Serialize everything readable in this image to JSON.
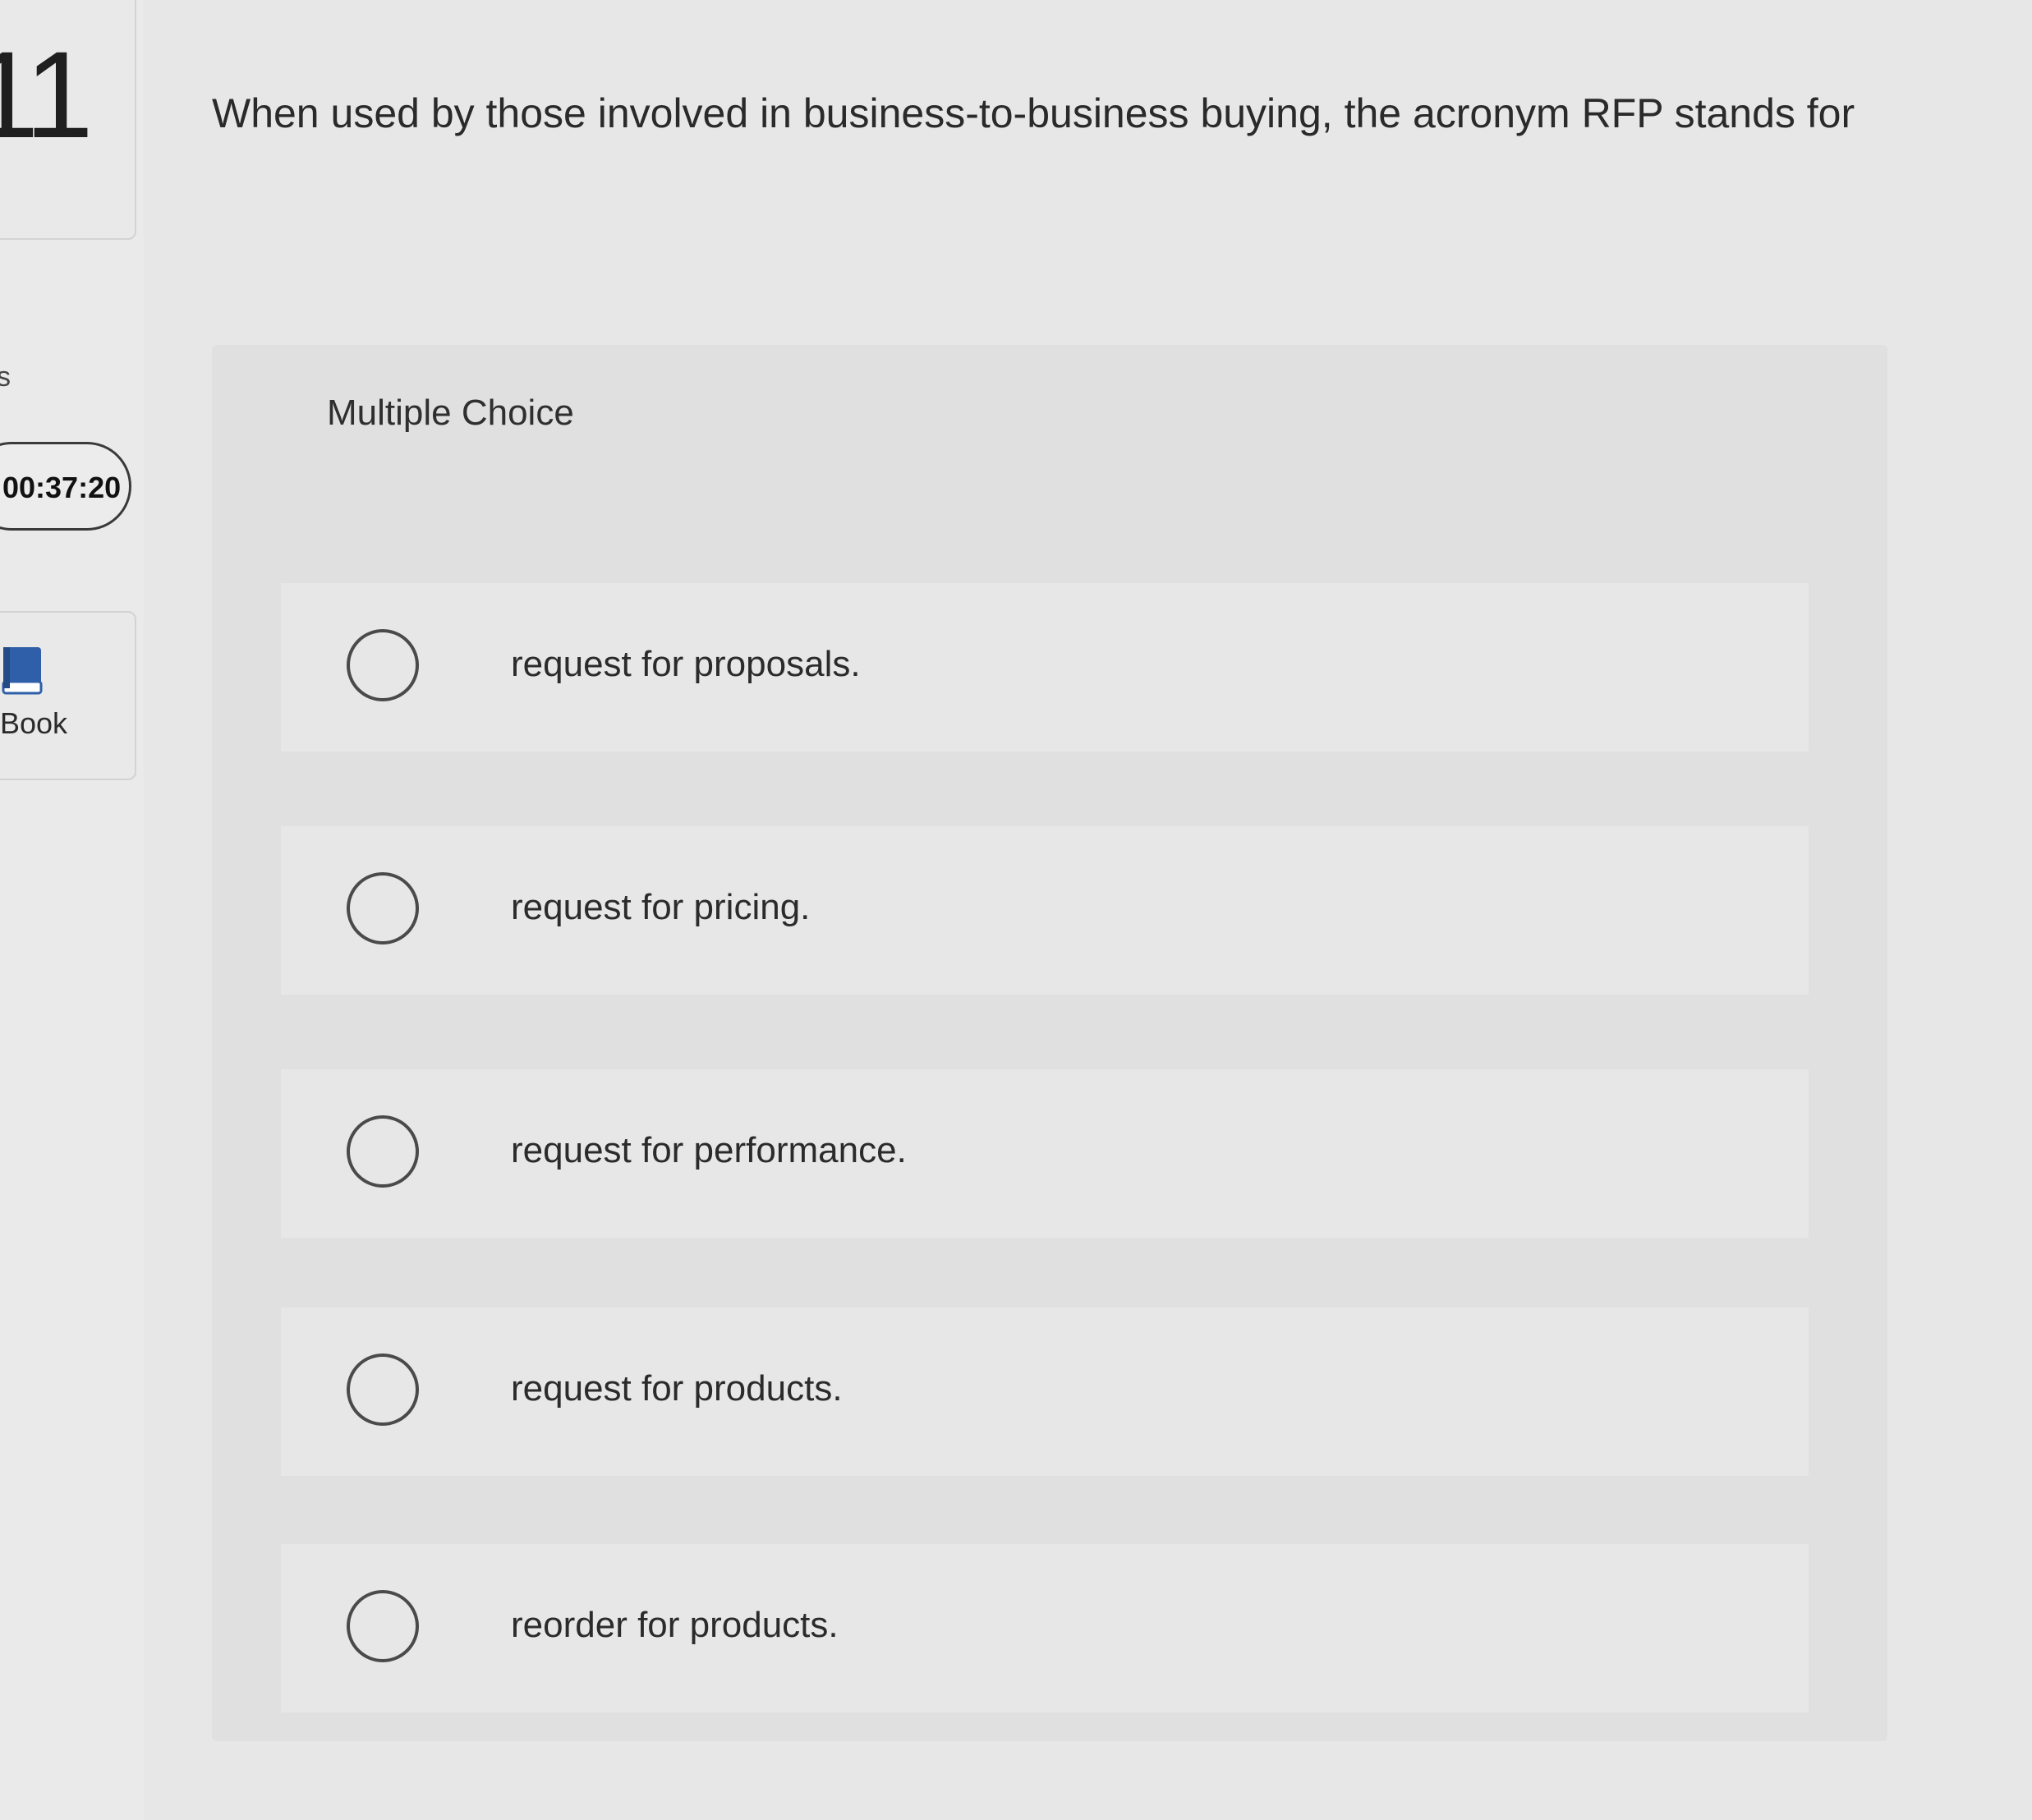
{
  "question_number": "11",
  "rail_fragment": "s",
  "timer": "00:37:20",
  "book": {
    "label": "Book",
    "icon": "book-icon"
  },
  "question": {
    "text": "When used by those involved in business-to-business buying, the acronym RFP stands for"
  },
  "answer_type_label": "Multiple Choice",
  "choices": [
    {
      "text": "request for proposals."
    },
    {
      "text": "request for pricing."
    },
    {
      "text": "request for performance."
    },
    {
      "text": "request for products."
    },
    {
      "text": "reorder for products."
    }
  ],
  "colors": {
    "background": "#e6e7e6",
    "panel": "#dfe0df",
    "book_icon": "#2f5fa8"
  }
}
